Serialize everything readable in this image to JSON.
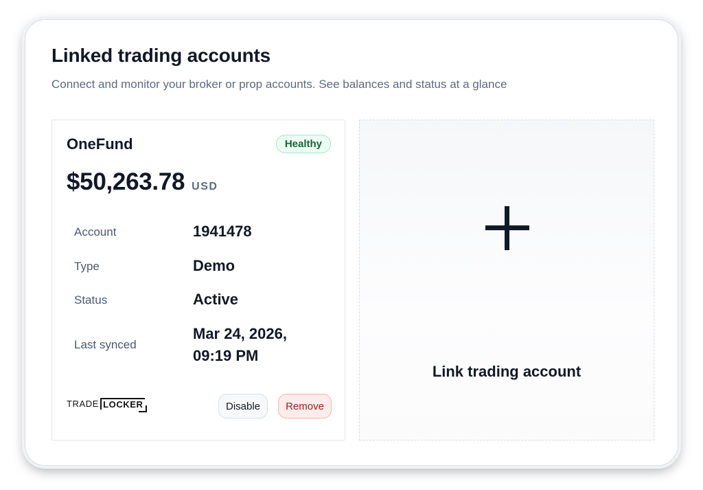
{
  "header": {
    "title": "Linked trading accounts",
    "subtitle": "Connect and monitor your broker or prop accounts. See balances and status at a glance"
  },
  "account_card": {
    "name": "OneFund",
    "status_badge": "Healthy",
    "balance": "$50,263.78",
    "currency": "USD",
    "details": [
      {
        "label": "Account",
        "value": "1941478"
      },
      {
        "label": "Type",
        "value": "Demo"
      },
      {
        "label": "Status",
        "value": "Active"
      },
      {
        "label": "Last synced",
        "value": "Mar 24, 2026, 09:19 PM"
      }
    ],
    "logo": {
      "part1": "TRADE",
      "part2": "LOCKER"
    },
    "disable_label": "Disable",
    "remove_label": "Remove"
  },
  "add_card": {
    "icon": "plus-icon",
    "label": "Link trading account"
  },
  "colors": {
    "badge_bg": "#ecfdf3",
    "badge_text": "#166534",
    "remove_bg": "#fdeceb",
    "remove_text": "#9b1c1c",
    "muted_text": "#5b6b80"
  }
}
